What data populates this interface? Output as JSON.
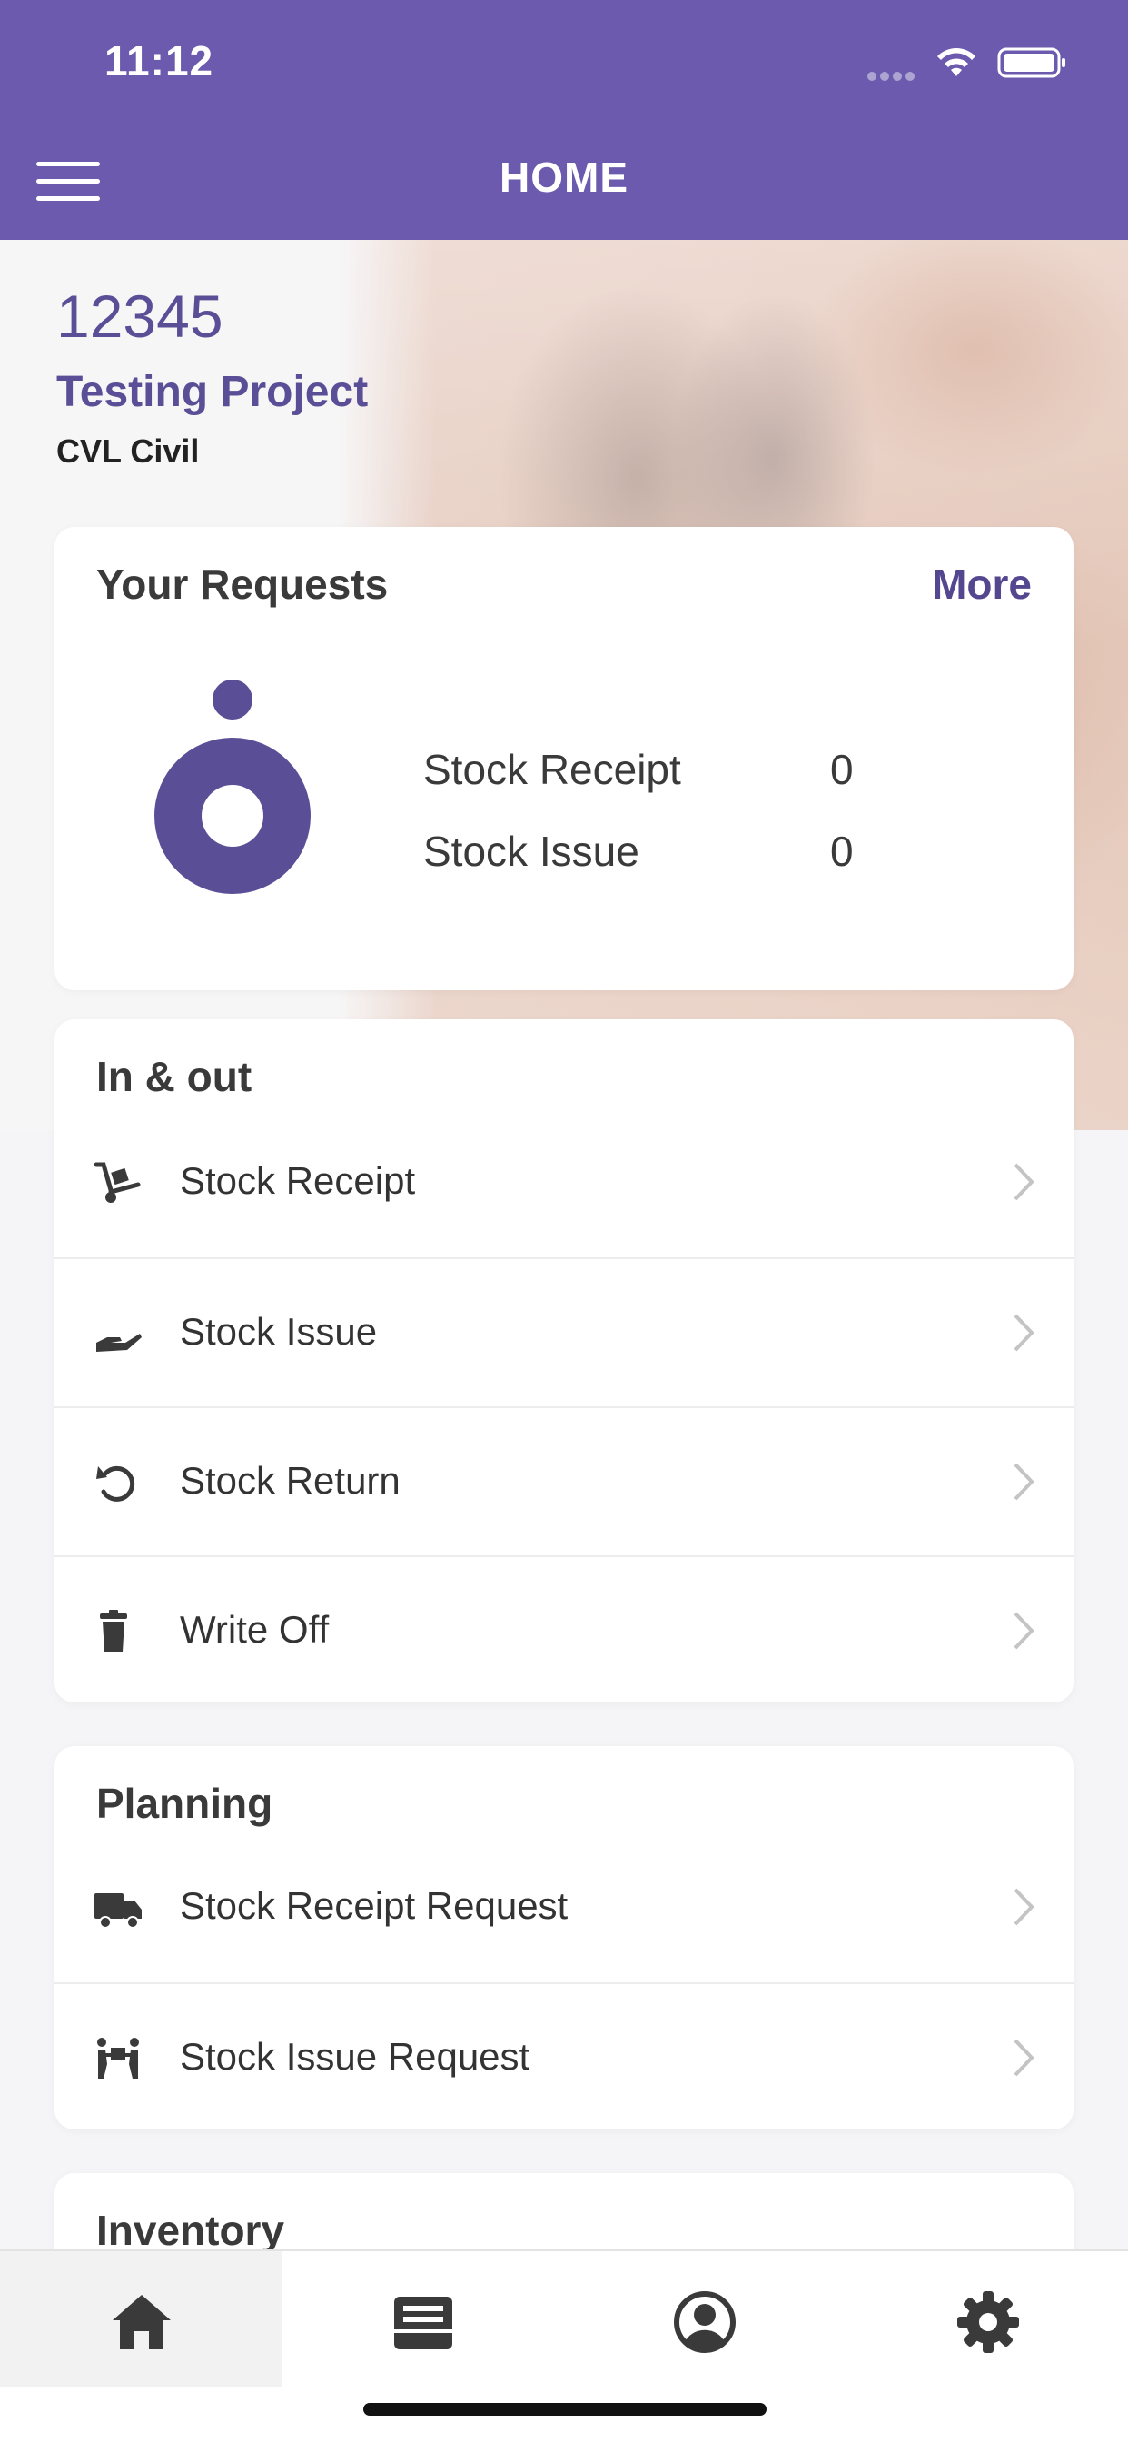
{
  "status_bar": {
    "time": "11:12"
  },
  "header": {
    "title": "HOME"
  },
  "project": {
    "id": "12345",
    "name": "Testing Project",
    "department": "CVL Civil"
  },
  "requests": {
    "title": "Your Requests",
    "more_label": "More",
    "items": [
      {
        "label": "Stock Receipt",
        "value": "0"
      },
      {
        "label": "Stock Issue",
        "value": "0"
      }
    ]
  },
  "in_out": {
    "title": "In & out",
    "items": [
      {
        "label": "Stock Receipt",
        "icon": "hand-truck-icon"
      },
      {
        "label": "Stock Issue",
        "icon": "hand-icon"
      },
      {
        "label": "Stock Return",
        "icon": "undo-icon"
      },
      {
        "label": "Write Off",
        "icon": "trash-icon"
      }
    ]
  },
  "planning": {
    "title": "Planning",
    "items": [
      {
        "label": "Stock Receipt Request",
        "icon": "truck-icon"
      },
      {
        "label": "Stock Issue Request",
        "icon": "people-carry-icon"
      }
    ]
  },
  "inventory": {
    "title": "Inventory"
  },
  "tabbar": {
    "tabs": [
      {
        "name": "home",
        "icon": "home-icon",
        "active": true
      },
      {
        "name": "inbox",
        "icon": "inbox-icon",
        "active": false
      },
      {
        "name": "profile",
        "icon": "user-icon",
        "active": false
      },
      {
        "name": "settings",
        "icon": "gear-icon",
        "active": false
      }
    ]
  },
  "colors": {
    "primary": "#6b5aad",
    "accent_text": "#5a4f96",
    "donut": "#5a4f96"
  }
}
